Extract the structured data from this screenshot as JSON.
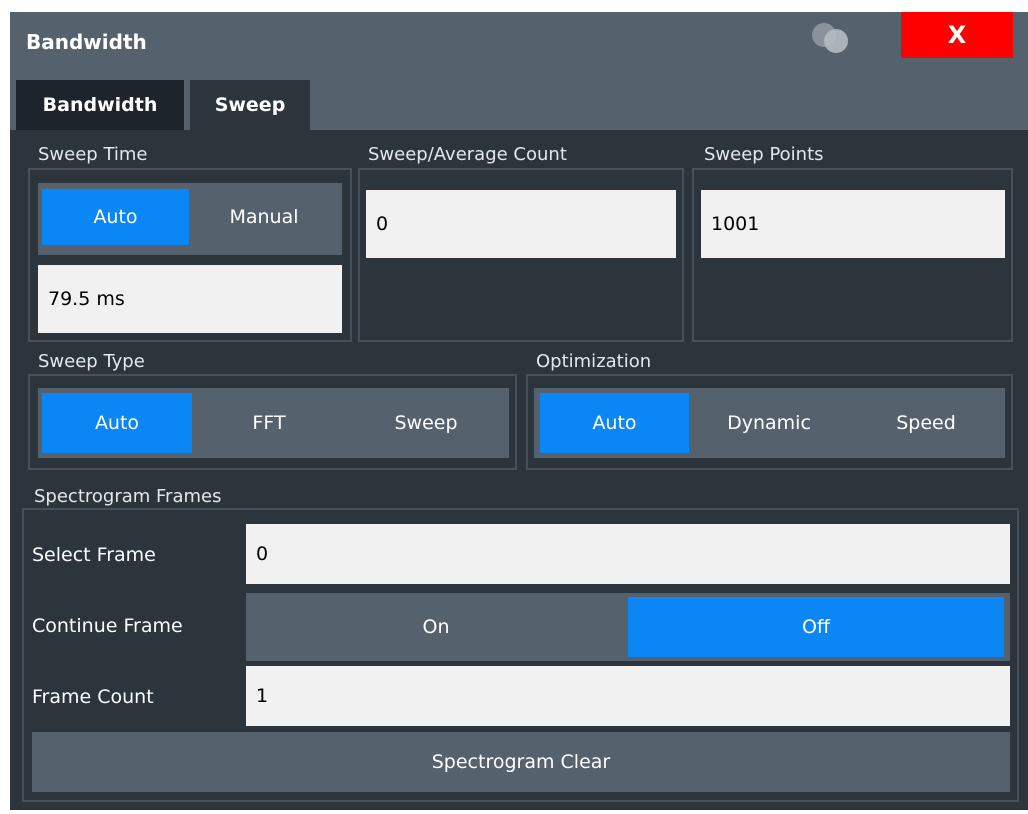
{
  "window": {
    "title": "Bandwidth",
    "close_label": "X",
    "icons": {
      "logo": "overlapping-circles-icon"
    }
  },
  "tabs": [
    {
      "label": "Bandwidth",
      "active": false
    },
    {
      "label": "Sweep",
      "active": true
    }
  ],
  "sweep_time": {
    "label": "Sweep Time",
    "options": [
      "Auto",
      "Manual"
    ],
    "selected": "Auto",
    "value": "79.5 ms"
  },
  "sweep_average_count": {
    "label": "Sweep/Average Count",
    "value": "0"
  },
  "sweep_points": {
    "label": "Sweep Points",
    "value": "1001"
  },
  "sweep_type": {
    "label": "Sweep Type",
    "options": [
      "Auto",
      "FFT",
      "Sweep"
    ],
    "selected": "Auto"
  },
  "optimization": {
    "label": "Optimization",
    "options": [
      "Auto",
      "Dynamic",
      "Speed"
    ],
    "selected": "Auto"
  },
  "spectrogram_frames": {
    "label": "Spectrogram Frames",
    "select_frame": {
      "label": "Select Frame",
      "value": "0"
    },
    "continue_frame": {
      "label": "Continue Frame",
      "options": [
        "On",
        "Off"
      ],
      "selected": "Off"
    },
    "frame_count": {
      "label": "Frame Count",
      "value": "1"
    },
    "clear_button": "Spectrogram Clear"
  },
  "colors": {
    "accent": "#0a86f5",
    "close": "#ff0000",
    "titlebar": "#56616e",
    "panel": "#2c343c",
    "field": "#f1f1f1"
  }
}
